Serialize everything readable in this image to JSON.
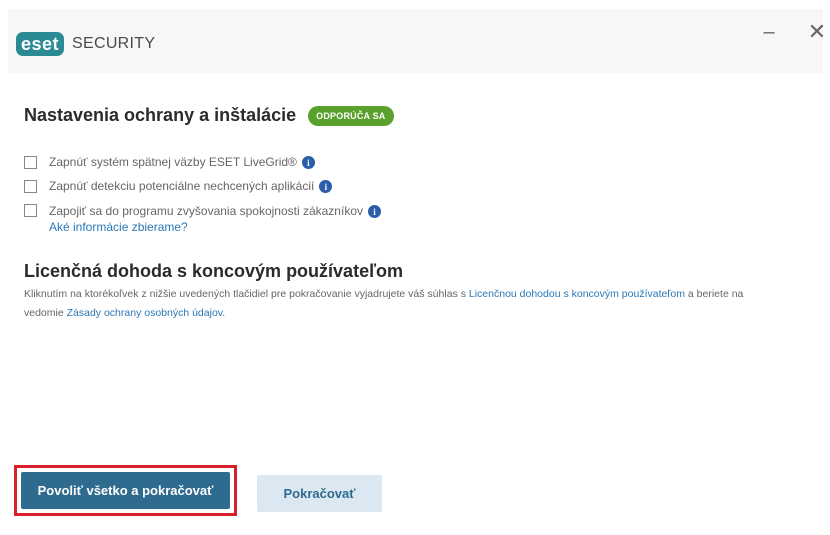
{
  "titlebar": {
    "logo_text": "eset",
    "product": "SECURITY",
    "minimize_label": "–",
    "close_label": "✕"
  },
  "protection": {
    "heading": "Nastavenia ochrany a inštalácie",
    "recommended_badge": "ODPORÚČA SA",
    "options": [
      {
        "label": "Zapnúť systém spätnej väzby ESET LiveGrid®",
        "checked": false
      },
      {
        "label": "Zapnúť detekciu potenciálne nechcených aplikácií",
        "checked": false
      },
      {
        "label": "Zapojiť sa do programu zvyšovania spokojnosti zákazníkov",
        "checked": false
      }
    ],
    "info_glyph": "i",
    "info_link": "Aké informácie zbierame?"
  },
  "eula": {
    "heading": "Licenčná dohoda s koncovým používateľom",
    "text_part1": "Kliknutím na ktorékoľvek z nižšie uvedených tlačidiel pre pokračovanie vyjadrujete váš súhlas s ",
    "link_eula": "Licenčnou dohodou s koncovým používateľom",
    "text_part2": " a beriete na vedomie ",
    "link_privacy": "Zásady ochrany osobných údajov",
    "text_part3": "."
  },
  "buttons": {
    "allow_all": "Povoliť všetko a pokračovať",
    "continue": "Pokračovať"
  },
  "colors": {
    "brand": "#2b8a93",
    "badge": "#5aa02c",
    "primary_button": "#2f6b8e",
    "highlight_border": "#d9202a",
    "link": "#2a78b7"
  }
}
